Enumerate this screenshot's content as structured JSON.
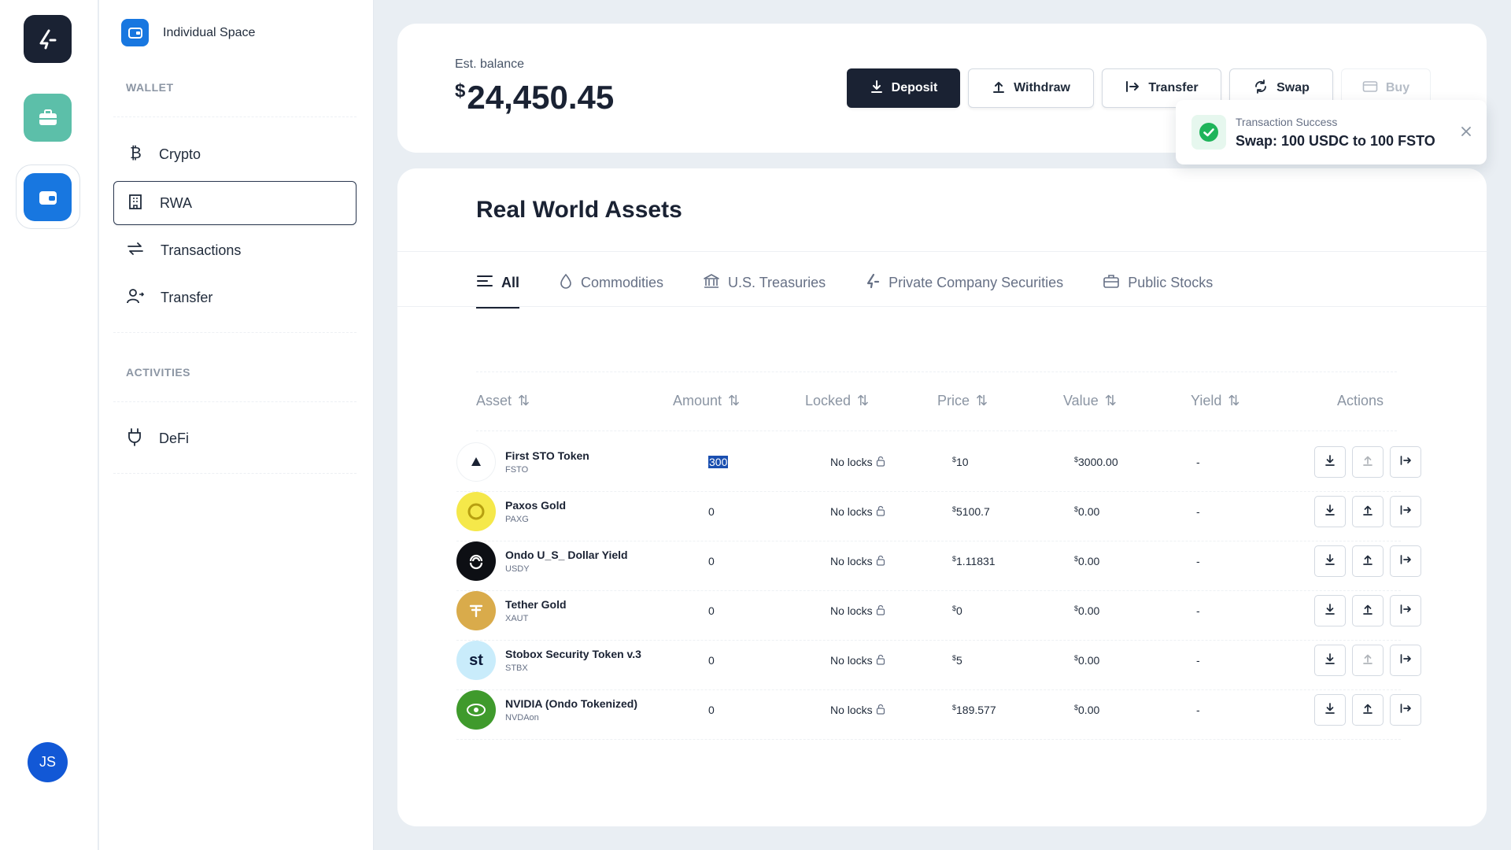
{
  "rail": {
    "logo_icon": "brand-logo-icon",
    "items": [
      "portfolio-icon",
      "wallet-icon"
    ],
    "avatar_initials": "JS"
  },
  "sidenav": {
    "space_label": "Individual Space",
    "wallet_section": "WALLET",
    "items": [
      {
        "label": "Crypto",
        "icon": "bitcoin-icon"
      },
      {
        "label": "RWA",
        "icon": "building-icon"
      },
      {
        "label": "Transactions",
        "icon": "exchange-arrows-icon"
      },
      {
        "label": "Transfer",
        "icon": "users-transfer-icon"
      }
    ],
    "activities_section": "ACTIVITIES",
    "activities": [
      {
        "label": "DeFi",
        "icon": "plug-icon"
      }
    ]
  },
  "balance": {
    "label": "Est. balance",
    "currency": "$",
    "value": "24,450.45"
  },
  "actions": {
    "deposit": "Deposit",
    "withdraw": "Withdraw",
    "transfer": "Transfer",
    "swap": "Swap",
    "buy": "Buy"
  },
  "toast": {
    "title": "Transaction Success",
    "message": "Swap: 100 USDC to 100 FSTO"
  },
  "assets": {
    "title": "Real World Assets",
    "tabs": [
      {
        "label": "All",
        "icon": "list-icon"
      },
      {
        "label": "Commodities",
        "icon": "drop-icon"
      },
      {
        "label": "U.S. Treasuries",
        "icon": "bank-icon"
      },
      {
        "label": "Private Company Securities",
        "icon": "brand-logo-icon"
      },
      {
        "label": "Public Stocks",
        "icon": "briefcase-icon"
      }
    ],
    "columns": [
      "Asset",
      "Amount",
      "Locked",
      "Price",
      "Value",
      "Yield",
      "Actions"
    ],
    "rows": [
      {
        "name": "First STO Token",
        "symbol": "FSTO",
        "amount": "300",
        "locked": "No locks",
        "price": "10",
        "value": "3000.00",
        "yield": "-",
        "logo_color": "#ffffff",
        "withdraw_enabled": false
      },
      {
        "name": "Paxos Gold",
        "symbol": "PAXG",
        "amount": "0",
        "locked": "No locks",
        "price": "5100.7",
        "value": "0.00",
        "yield": "-",
        "logo_color": "#f5e84a",
        "withdraw_enabled": true
      },
      {
        "name": "Ondo U_S_ Dollar Yield",
        "symbol": "USDY",
        "amount": "0",
        "locked": "No locks",
        "price": "1.11831",
        "value": "0.00",
        "yield": "-",
        "logo_color": "#0d0f14",
        "withdraw_enabled": true
      },
      {
        "name": "Tether Gold",
        "symbol": "XAUT",
        "amount": "0",
        "locked": "No locks",
        "price": "0",
        "value": "0.00",
        "yield": "-",
        "logo_color": "#d9ab4b",
        "withdraw_enabled": true
      },
      {
        "name": "Stobox Security Token v.3",
        "symbol": "STBX",
        "amount": "0",
        "locked": "No locks",
        "price": "5",
        "value": "0.00",
        "yield": "-",
        "logo_color": "#c9ecfb",
        "withdraw_enabled": false
      },
      {
        "name": "NVIDIA (Ondo Tokenized)",
        "symbol": "NVDAon",
        "amount": "0",
        "locked": "No locks",
        "price": "189.577",
        "value": "0.00",
        "yield": "-",
        "logo_color": "#3f9a2c",
        "withdraw_enabled": true
      }
    ],
    "currency_symbol": "$",
    "stol_logo_text": "st"
  },
  "colors": {
    "primary_dark": "#1a2233",
    "accent_blue": "#1877e0",
    "teal": "#5cbfa9",
    "success": "#1fb45a"
  }
}
